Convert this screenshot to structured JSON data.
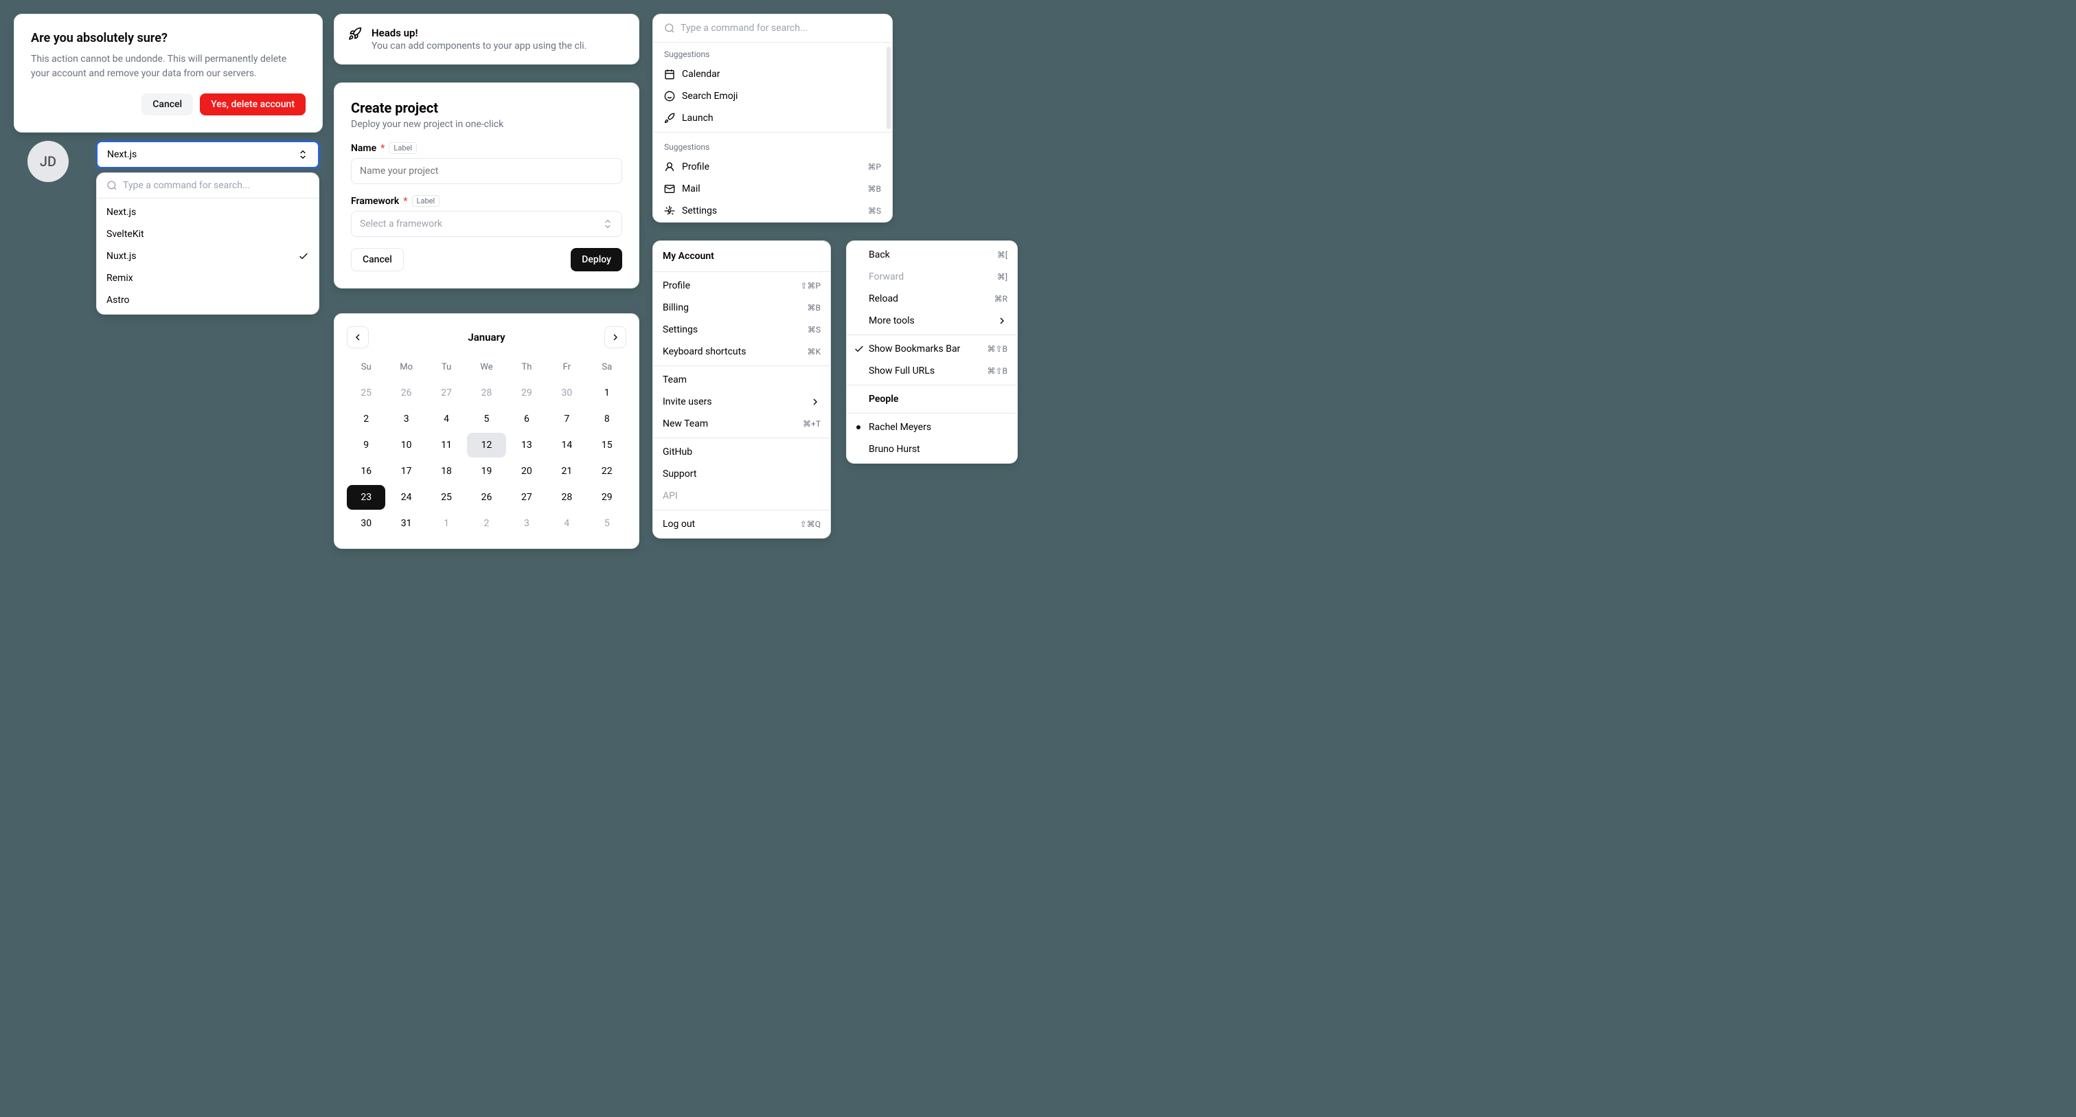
{
  "alert": {
    "title": "Are you absolutely sure?",
    "body": "This action cannot be undonde. This will permanently delete your account and remove your data from our servers.",
    "cancel": "Cancel",
    "confirm": "Yes, delete account"
  },
  "avatar": {
    "initials": "JD"
  },
  "combobox": {
    "trigger": "Next.js",
    "search_placeholder": "Type a command for search...",
    "items": [
      {
        "label": "Next.js",
        "selected": false
      },
      {
        "label": "SvelteKit",
        "selected": false
      },
      {
        "label": "Nuxt.js",
        "selected": true
      },
      {
        "label": "Remix",
        "selected": false
      },
      {
        "label": "Astro",
        "selected": false
      }
    ]
  },
  "headsup": {
    "title": "Heads up!",
    "body": "You can add components to your app using the cli."
  },
  "project": {
    "title": "Create project",
    "subtitle": "Deploy your new project in one-click",
    "name_label": "Name",
    "name_pill": "Label",
    "name_placeholder": "Name your project",
    "framework_label": "Framework",
    "framework_pill": "Label",
    "framework_placeholder": "Select a framework",
    "cancel": "Cancel",
    "deploy": "Deploy"
  },
  "calendar": {
    "month": "January",
    "dow": [
      "Su",
      "Mo",
      "Tu",
      "We",
      "Th",
      "Fr",
      "Sa"
    ],
    "days": [
      {
        "n": "25",
        "muted": true
      },
      {
        "n": "26",
        "muted": true
      },
      {
        "n": "27",
        "muted": true
      },
      {
        "n": "28",
        "muted": true
      },
      {
        "n": "29",
        "muted": true
      },
      {
        "n": "30",
        "muted": true
      },
      {
        "n": "1"
      },
      {
        "n": "2"
      },
      {
        "n": "3"
      },
      {
        "n": "4"
      },
      {
        "n": "5"
      },
      {
        "n": "6"
      },
      {
        "n": "7"
      },
      {
        "n": "8"
      },
      {
        "n": "9"
      },
      {
        "n": "10"
      },
      {
        "n": "11"
      },
      {
        "n": "12",
        "today": true
      },
      {
        "n": "13"
      },
      {
        "n": "14"
      },
      {
        "n": "15"
      },
      {
        "n": "16"
      },
      {
        "n": "17"
      },
      {
        "n": "18"
      },
      {
        "n": "19"
      },
      {
        "n": "20"
      },
      {
        "n": "21"
      },
      {
        "n": "22"
      },
      {
        "n": "23",
        "selected": true
      },
      {
        "n": "24"
      },
      {
        "n": "25"
      },
      {
        "n": "26"
      },
      {
        "n": "27"
      },
      {
        "n": "28"
      },
      {
        "n": "29"
      },
      {
        "n": "30"
      },
      {
        "n": "31"
      },
      {
        "n": "1",
        "muted": true
      },
      {
        "n": "2",
        "muted": true
      },
      {
        "n": "3",
        "muted": true
      },
      {
        "n": "4",
        "muted": true
      },
      {
        "n": "5",
        "muted": true
      }
    ]
  },
  "palette": {
    "search_placeholder": "Type a command for search...",
    "group1_label": "Suggestions",
    "group1": [
      {
        "icon": "calendar-icon",
        "label": "Calendar"
      },
      {
        "icon": "smile-icon",
        "label": "Search Emoji"
      },
      {
        "icon": "rocket-icon",
        "label": "Launch"
      }
    ],
    "group2_label": "Suggestions",
    "group2": [
      {
        "icon": "user-icon",
        "label": "Profile",
        "kbd": "⌘P"
      },
      {
        "icon": "mail-icon",
        "label": "Mail",
        "kbd": "⌘B"
      },
      {
        "icon": "gear-icon",
        "label": "Settings",
        "kbd": "⌘S"
      }
    ]
  },
  "account": {
    "title": "My Account",
    "g1": [
      {
        "label": "Profile",
        "kbd": "⇧⌘P"
      },
      {
        "label": "Billing",
        "kbd": "⌘B"
      },
      {
        "label": "Settings",
        "kbd": "⌘S"
      },
      {
        "label": "Keyboard shortcuts",
        "kbd": "⌘K"
      }
    ],
    "g2": [
      {
        "label": "Team"
      },
      {
        "label": "Invite users",
        "chevron": true
      },
      {
        "label": "New Team",
        "kbd": "⌘+T"
      }
    ],
    "g3": [
      {
        "label": "GitHub"
      },
      {
        "label": "Support"
      },
      {
        "label": "API",
        "disabled": true
      }
    ],
    "logout": {
      "label": "Log out",
      "kbd": "⇧⌘Q"
    }
  },
  "ctx": {
    "g1": [
      {
        "label": "Back",
        "kbd": "⌘["
      },
      {
        "label": "Forward",
        "kbd": "⌘]",
        "disabled": true
      },
      {
        "label": "Reload",
        "kbd": "⌘R"
      },
      {
        "label": "More tools",
        "chevron": true
      }
    ],
    "g2": [
      {
        "label": "Show Bookmarks Bar",
        "kbd": "⌘⇧B",
        "checked": true
      },
      {
        "label": "Show Full URLs",
        "kbd": "⌘⇧B"
      }
    ],
    "people_label": "People",
    "people": [
      {
        "label": "Rachel Meyers",
        "selected": true
      },
      {
        "label": "Bruno Hurst"
      }
    ]
  }
}
